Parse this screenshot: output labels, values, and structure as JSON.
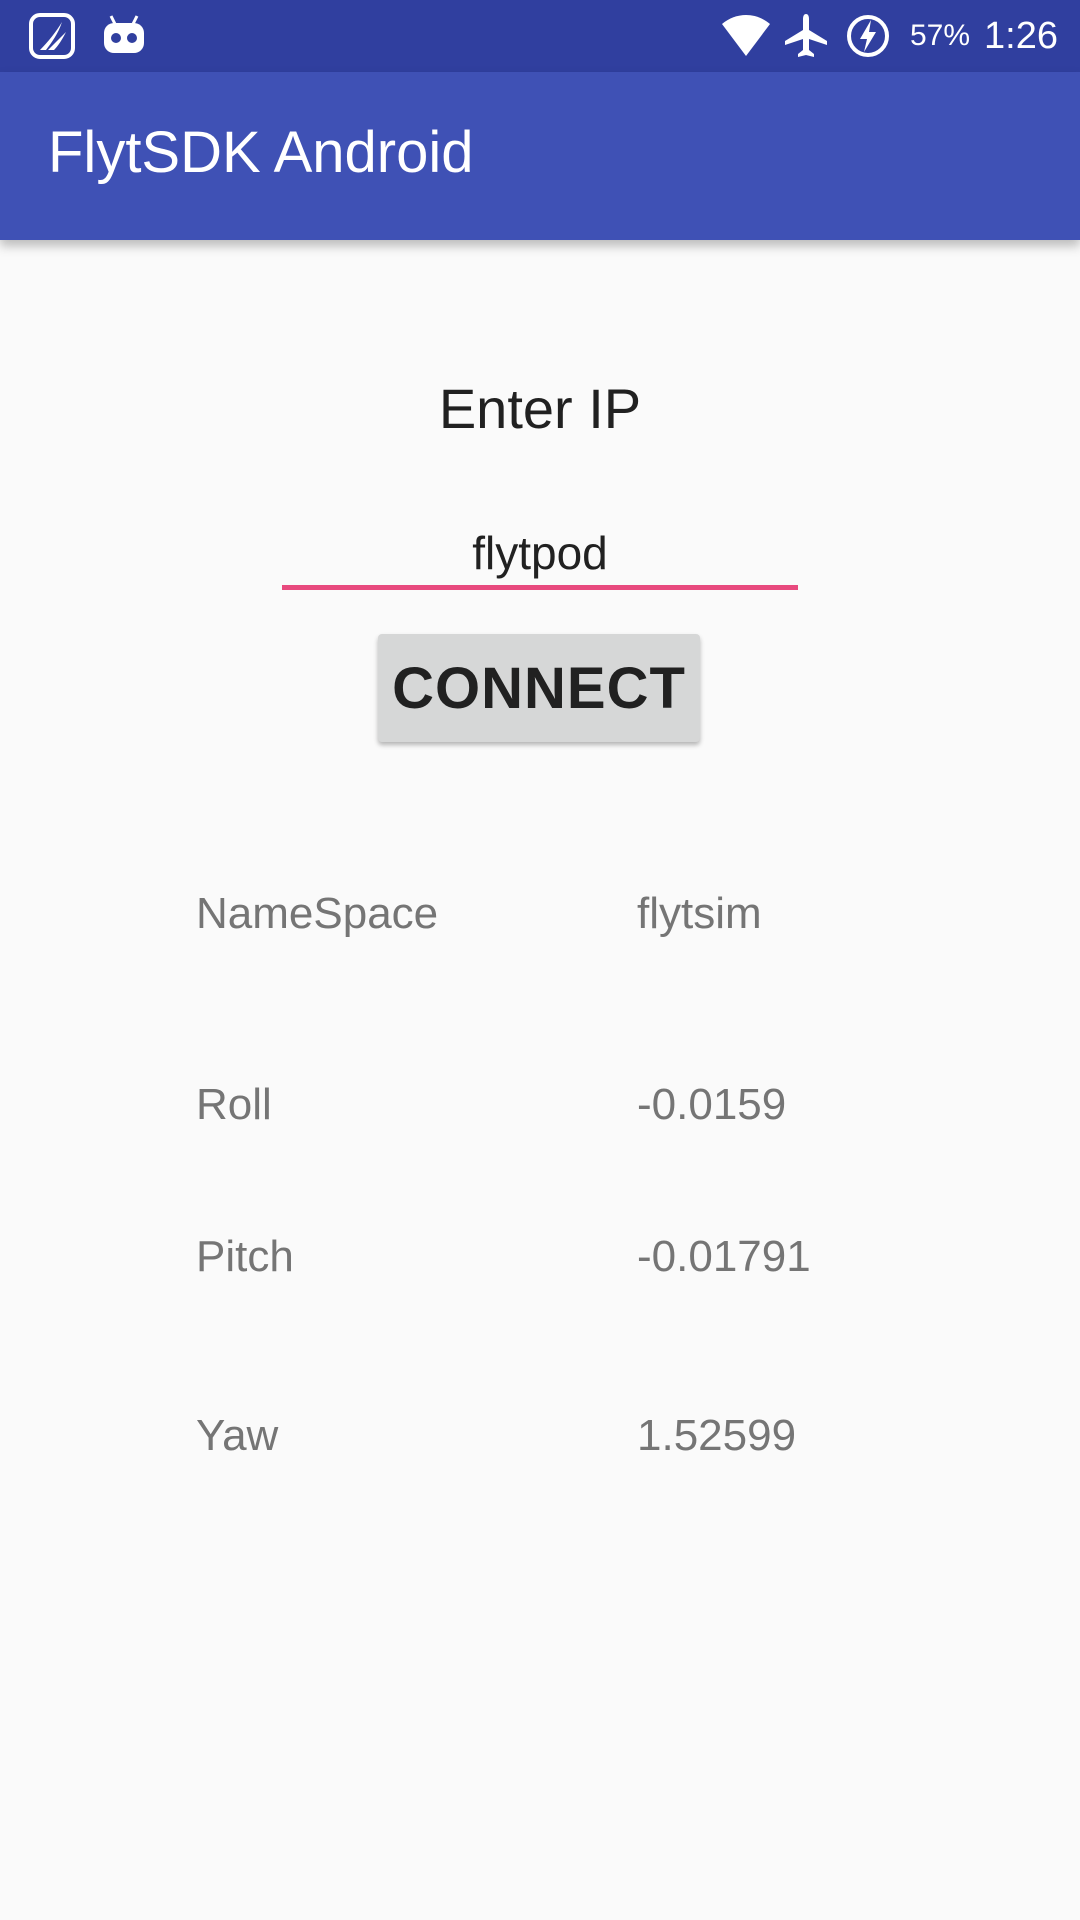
{
  "status_bar": {
    "left_icons": [
      "saavn-icon",
      "android-robot-icon"
    ],
    "right_icons": [
      "wifi-icon",
      "airplane-icon",
      "battery-charging-icon"
    ],
    "battery_percent": "57%",
    "time": "1:26",
    "background_color": "#303f9f"
  },
  "app_bar": {
    "title": "FlytSDK Android",
    "background_color": "#3f51b5"
  },
  "form": {
    "prompt": "Enter IP",
    "ip_value": "flytpod",
    "underline_color": "#e84a7e",
    "connect_label": "CONNECT"
  },
  "telemetry": [
    {
      "label": "NameSpace",
      "value": "flytsim"
    },
    {
      "label": "Roll",
      "value": "-0.0159"
    },
    {
      "label": "Pitch",
      "value": "-0.01791"
    },
    {
      "label": "Yaw",
      "value": "1.52599"
    }
  ]
}
